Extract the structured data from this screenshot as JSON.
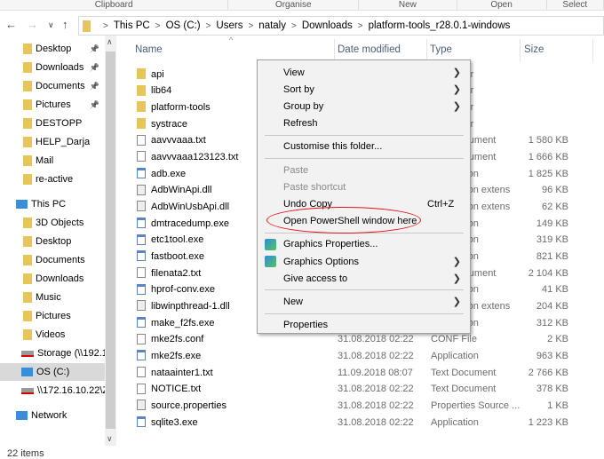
{
  "ribbon": [
    "Clipboard",
    "Organise",
    "New",
    "Open",
    "Select"
  ],
  "breadcrumb": [
    "This PC",
    "OS (C:)",
    "Users",
    "nataly",
    "Downloads",
    "platform-tools_r28.0.1-windows"
  ],
  "sidebar": [
    {
      "label": "Desktop",
      "icon": "desktop-folder-icon",
      "pinned": true
    },
    {
      "label": "Downloads",
      "icon": "downloads-folder-icon",
      "pinned": true
    },
    {
      "label": "Documents",
      "icon": "documents-folder-icon",
      "pinned": true
    },
    {
      "label": "Pictures",
      "icon": "pictures-folder-icon",
      "pinned": true
    },
    {
      "label": "DESTOPP",
      "icon": "folder-icon"
    },
    {
      "label": "HELP_Darja",
      "icon": "folder-icon"
    },
    {
      "label": "Mail",
      "icon": "folder-icon"
    },
    {
      "label": "re-active",
      "icon": "folder-icon"
    },
    {
      "label": "This PC",
      "icon": "computer-icon"
    },
    {
      "label": "3D Objects",
      "icon": "folder-icon"
    },
    {
      "label": "Desktop",
      "icon": "folder-icon"
    },
    {
      "label": "Documents",
      "icon": "folder-icon"
    },
    {
      "label": "Downloads",
      "icon": "folder-icon"
    },
    {
      "label": "Music",
      "icon": "folder-icon"
    },
    {
      "label": "Pictures",
      "icon": "folder-icon"
    },
    {
      "label": "Videos",
      "icon": "folder-icon"
    },
    {
      "label": "Storage (\\\\192.1",
      "icon": "network-drive-disconnected-icon"
    },
    {
      "label": "OS (C:)",
      "icon": "drive-icon",
      "selected": true
    },
    {
      "label": "\\\\172.16.10.22\\Z",
      "icon": "network-drive-disconnected-icon"
    },
    {
      "label": "Network",
      "icon": "network-icon"
    }
  ],
  "columns": {
    "name": "Name",
    "date": "Date modified",
    "type": "Type",
    "size": "Size"
  },
  "files": [
    {
      "name": "api",
      "kind": "folder",
      "date": "",
      "type": "File folder",
      "size": ""
    },
    {
      "name": "lib64",
      "kind": "folder",
      "date": "",
      "type": "File folder",
      "size": ""
    },
    {
      "name": "platform-tools",
      "kind": "folder",
      "date": "",
      "type": "File folder",
      "size": ""
    },
    {
      "name": "systrace",
      "kind": "folder",
      "date": "",
      "type": "File folder",
      "size": ""
    },
    {
      "name": "aavvvaaa.txt",
      "kind": "txt",
      "date": "",
      "type": "Text Document",
      "size": "1 580 KB"
    },
    {
      "name": "aavvvaaa123123.txt",
      "kind": "txt",
      "date": "",
      "type": "Text Document",
      "size": "1 666 KB"
    },
    {
      "name": "adb.exe",
      "kind": "exe",
      "date": "",
      "type": "Application",
      "size": "1 825 KB"
    },
    {
      "name": "AdbWinApi.dll",
      "kind": "dll",
      "date": "",
      "type": "Application extens",
      "size": "96 KB"
    },
    {
      "name": "AdbWinUsbApi.dll",
      "kind": "dll",
      "date": "",
      "type": "Application extens",
      "size": "62 KB"
    },
    {
      "name": "dmtracedump.exe",
      "kind": "exe",
      "date": "",
      "type": "Application",
      "size": "149 KB"
    },
    {
      "name": "etc1tool.exe",
      "kind": "exe",
      "date": "",
      "type": "Application",
      "size": "319 KB"
    },
    {
      "name": "fastboot.exe",
      "kind": "exe",
      "date": "",
      "type": "Application",
      "size": "821 KB"
    },
    {
      "name": "filenata2.txt",
      "kind": "txt",
      "date": "",
      "type": "Text Document",
      "size": "2 104 KB"
    },
    {
      "name": "hprof-conv.exe",
      "kind": "exe",
      "date": "",
      "type": "Application",
      "size": "41 KB"
    },
    {
      "name": "libwinpthread-1.dll",
      "kind": "dll",
      "date": "",
      "type": "Application extens",
      "size": "204 KB"
    },
    {
      "name": "make_f2fs.exe",
      "kind": "exe",
      "date": "",
      "type": "Application",
      "size": "312 KB"
    },
    {
      "name": "mke2fs.conf",
      "kind": "txt",
      "date": "31.08.2018 02:22",
      "type": "CONF File",
      "size": "2 KB"
    },
    {
      "name": "mke2fs.exe",
      "kind": "exe",
      "date": "31.08.2018 02:22",
      "type": "Application",
      "size": "963 KB"
    },
    {
      "name": "nataainter1.txt",
      "kind": "txt",
      "date": "11.09.2018 08:07",
      "type": "Text Document",
      "size": "2 766 KB"
    },
    {
      "name": "NOTICE.txt",
      "kind": "txt",
      "date": "31.08.2018 02:22",
      "type": "Text Document",
      "size": "378 KB"
    },
    {
      "name": "source.properties",
      "kind": "dll",
      "date": "31.08.2018 02:22",
      "type": "Properties Source ...",
      "size": "1 KB"
    },
    {
      "name": "sqlite3.exe",
      "kind": "exe",
      "date": "31.08.2018 02:22",
      "type": "Application",
      "size": "1 223 KB"
    }
  ],
  "status": "22 items",
  "menu": [
    {
      "label": "View",
      "submenu": true
    },
    {
      "label": "Sort by",
      "submenu": true
    },
    {
      "label": "Group by",
      "submenu": true
    },
    {
      "label": "Refresh"
    },
    {
      "sep": true
    },
    {
      "label": "Customise this folder..."
    },
    {
      "sep": true
    },
    {
      "label": "Paste",
      "disabled": true
    },
    {
      "label": "Paste shortcut",
      "disabled": true
    },
    {
      "label": "Undo Copy",
      "shortcut": "Ctrl+Z"
    },
    {
      "label": "Open PowerShell window here",
      "highlighted_circle": true
    },
    {
      "sep": true
    },
    {
      "label": "Graphics Properties...",
      "icon": "graphics-icon"
    },
    {
      "label": "Graphics Options",
      "icon": "graphics-icon",
      "submenu": true
    },
    {
      "label": "Give access to",
      "submenu": true
    },
    {
      "sep": true
    },
    {
      "label": "New",
      "submenu": true
    },
    {
      "sep": true
    },
    {
      "label": "Properties"
    }
  ],
  "colors": {
    "annotation": "#e0131a",
    "header_text": "#4c607a",
    "selection": "#d9d9d9"
  }
}
